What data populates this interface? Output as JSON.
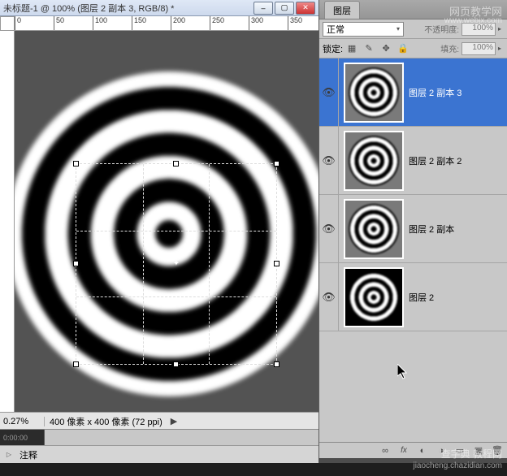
{
  "doc": {
    "title": "未标题-1 @ 100% (图层 2 副本 3, RGB/8) *",
    "zoom": "0.27%",
    "pixel_info": "400 像素 x 400 像素 (72 ppi)",
    "ruler_ticks": [
      "0",
      "50",
      "100",
      "150",
      "200",
      "250",
      "300",
      "350"
    ]
  },
  "timeline_hint": "0:00:00",
  "comment_label": "注释",
  "layers_panel": {
    "tab_label": "图层",
    "blend_mode": "正常",
    "opacity_label": "不透明度:",
    "opacity_value": "100%",
    "lock_label": "锁定:",
    "fill_label": "填充:",
    "fill_value": "100%",
    "lock_icons": [
      "pixels-lock-icon",
      "position-lock-icon",
      "brush-lock-icon",
      "all-lock-icon"
    ],
    "layers": [
      {
        "name": "图层 2 副本 3",
        "visible": true,
        "selected": true,
        "bg": "gray"
      },
      {
        "name": "图层 2 副本 2",
        "visible": true,
        "selected": false,
        "bg": "gray"
      },
      {
        "name": "图层 2 副本",
        "visible": true,
        "selected": false,
        "bg": "gray"
      },
      {
        "name": "图层 2",
        "visible": true,
        "selected": false,
        "bg": "black"
      }
    ],
    "bottom_icons": [
      "link-icon",
      "fx-icon",
      "mask-icon",
      "adjustment-icon",
      "group-icon",
      "new-layer-icon",
      "trash-icon"
    ]
  },
  "watermarks": {
    "top_right": "网页教学网",
    "top_right_url": "www.webjx.com",
    "bottom_right1": "查字典 教程网",
    "bottom_right2": "jiaocheng.chazidian.com"
  }
}
